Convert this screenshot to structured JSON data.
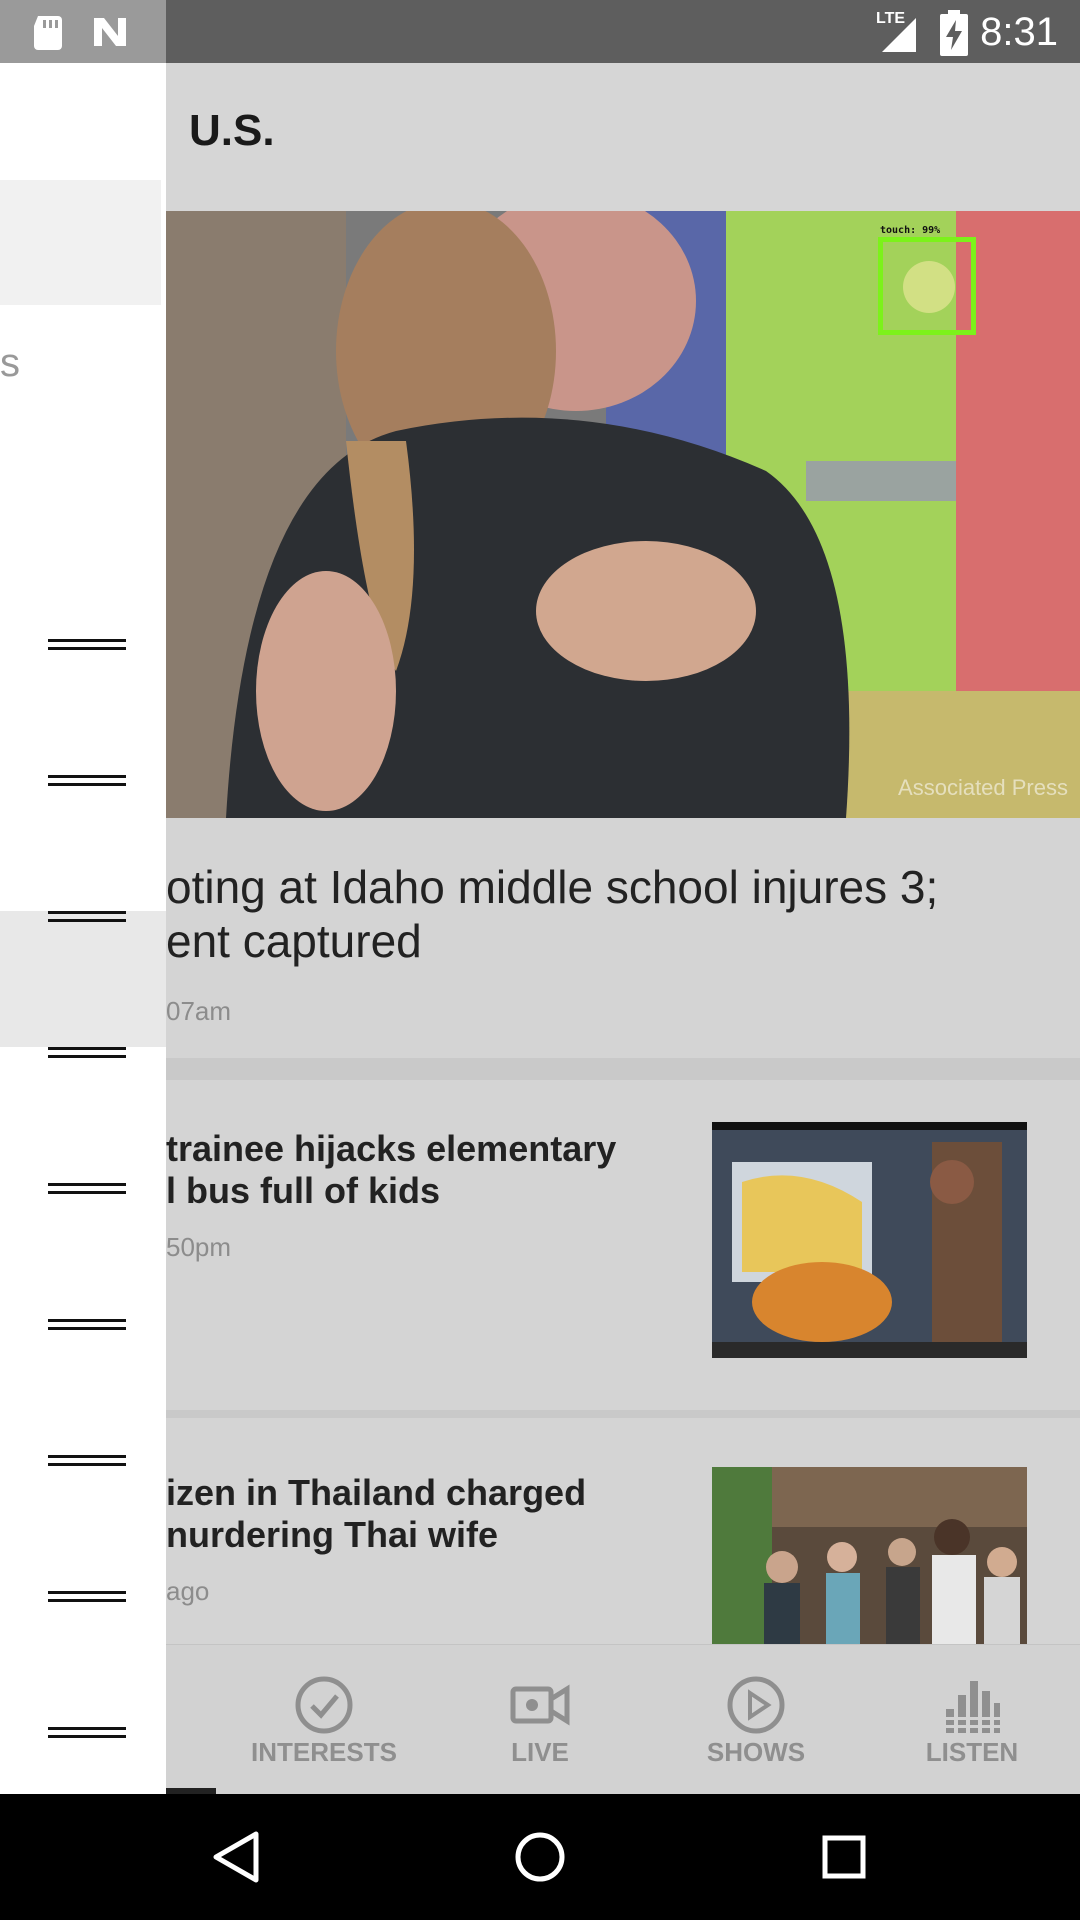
{
  "status_bar": {
    "time": "8:31",
    "network": "LTE",
    "icons": [
      "sd-card-icon",
      "n-icon",
      "signal-icon",
      "battery-charging-icon"
    ]
  },
  "header": {
    "section_title": "U.S."
  },
  "hero": {
    "credit": "Associated Press",
    "overlay_label": "touch: 99%"
  },
  "lead_story": {
    "headline": "oting at Idaho middle school injures 3; ent captured",
    "headline_line1": "oting at Idaho middle school injures 3;",
    "headline_line2": "ent captured",
    "timestamp": "07am"
  },
  "stories": [
    {
      "title_line1": "trainee hijacks elementary",
      "title_line2": "l bus full of kids",
      "timestamp": "50pm",
      "thumb_icon": "bus-hijack-photo"
    },
    {
      "title_line1": "izen in Thailand charged",
      "title_line2": "nurdering Thai wife",
      "timestamp": "ago",
      "thumb_icon": "group-photo"
    }
  ],
  "bottom_nav": {
    "items": [
      {
        "label": "INTERESTS",
        "icon": "check-circle-icon"
      },
      {
        "label": "LIVE",
        "icon": "video-camera-icon"
      },
      {
        "label": "SHOWS",
        "icon": "play-circle-icon"
      },
      {
        "label": "LISTEN",
        "icon": "equalizer-icon"
      }
    ]
  },
  "drawer": {
    "fragment_text": "s",
    "item_count": 9
  },
  "android_nav": {
    "buttons": [
      "back-icon",
      "home-icon",
      "recents-icon"
    ]
  }
}
